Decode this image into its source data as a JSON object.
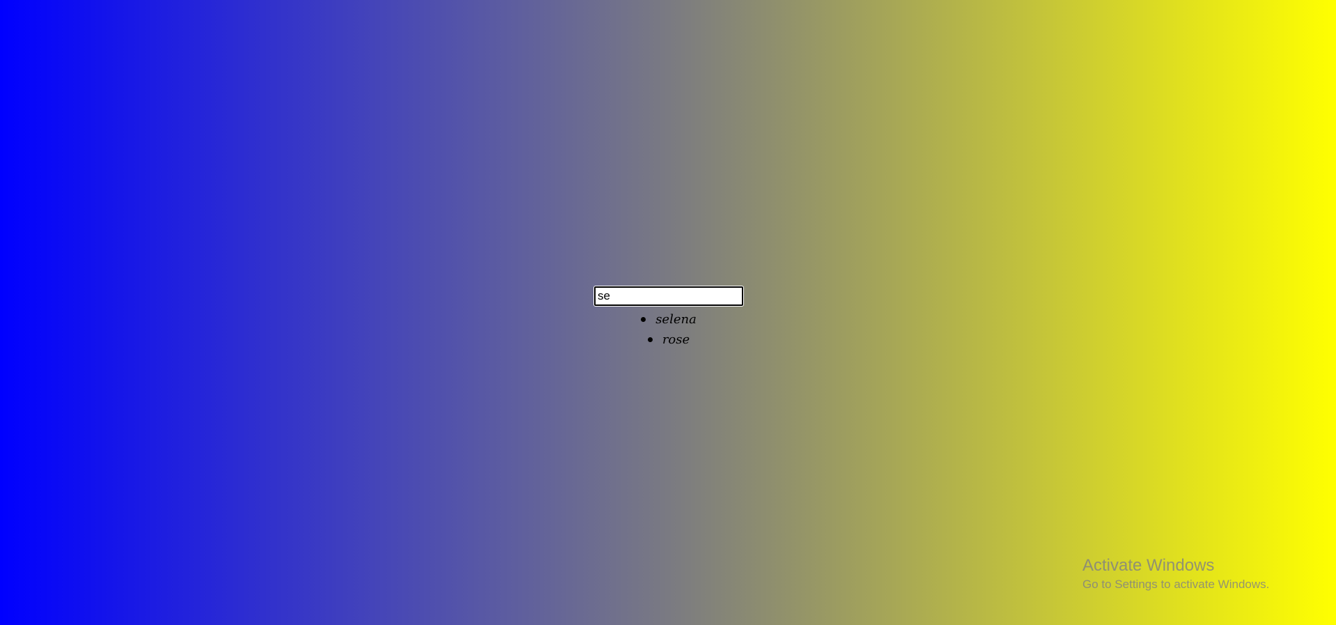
{
  "search": {
    "value": "se",
    "results": [
      {
        "label": "selena"
      },
      {
        "label": "rose"
      }
    ]
  },
  "watermark": {
    "title": "Activate Windows",
    "subtitle": "Go to Settings to activate Windows."
  },
  "colors": {
    "gradient_start": "#0000ff",
    "gradient_mid": "#7a7a82",
    "gradient_end": "#ffff00"
  }
}
